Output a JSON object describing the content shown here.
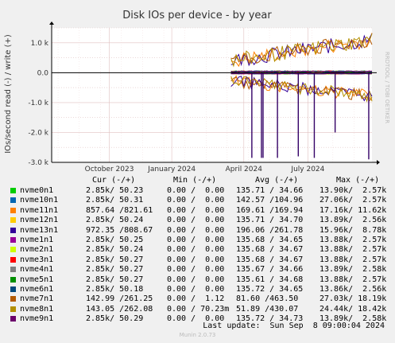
{
  "chart_data": {
    "type": "line",
    "title": "Disk IOs per device - by year",
    "ylabel": "IOs/second read (-) / write (+)",
    "watermark": "RRDTOOL / TOBI OETIKER",
    "ylim": [
      -3000,
      1500
    ],
    "y_ticks": [
      "1.5 k",
      "1.0 k",
      "0.5 k",
      "0.0",
      "-0.5 k",
      "-1.0 k",
      "-1.5 k",
      "-2.0 k",
      "-2.5 k",
      "-3.0 k"
    ],
    "x_ticks": [
      "October 2023",
      "January 2024",
      "April 2024",
      "July 2024"
    ],
    "columns": [
      "Cur (-/+)",
      "Min (-/+)",
      "Avg (-/+)",
      "Max (-/+)"
    ],
    "series": [
      {
        "name": "nvme0n1",
        "color": "#00cc00",
        "cur": "2.85k/ 50.23",
        "min": "0.00 /  0.00",
        "avg": "135.71 / 34.66",
        "max": "13.90k/  2.57k"
      },
      {
        "name": "nvme10n1",
        "color": "#0066b3",
        "cur": "2.85k/ 50.31",
        "min": "0.00 /  0.00",
        "avg": "142.57 /104.96",
        "max": "27.06k/  2.57k"
      },
      {
        "name": "nvme11n1",
        "color": "#ff8000",
        "cur": "857.64 /821.61",
        "min": "0.00 /  0.00",
        "avg": "169.61 /169.94",
        "max": "17.16k/ 11.62k"
      },
      {
        "name": "nvme12n1",
        "color": "#ffcc00",
        "cur": "2.85k/ 50.24",
        "min": "0.00 /  0.00",
        "avg": "135.71 / 34.70",
        "max": "13.89k/  2.56k"
      },
      {
        "name": "nvme13n1",
        "color": "#330099",
        "cur": "972.35 /808.67",
        "min": "0.00 /  0.00",
        "avg": "196.06 /261.78",
        "max": "15.96k/  8.78k"
      },
      {
        "name": "nvme1n1",
        "color": "#990099",
        "cur": "2.85k/ 50.25",
        "min": "0.00 /  0.00",
        "avg": "135.68 / 34.65",
        "max": "13.88k/  2.57k"
      },
      {
        "name": "nvme2n1",
        "color": "#ccff00",
        "cur": "2.85k/ 50.24",
        "min": "0.00 /  0.00",
        "avg": "135.68 / 34.67",
        "max": "13.88k/  2.57k"
      },
      {
        "name": "nvme3n1",
        "color": "#ff0000",
        "cur": "2.85k/ 50.27",
        "min": "0.00 /  0.00",
        "avg": "135.68 / 34.67",
        "max": "13.88k/  2.57k"
      },
      {
        "name": "nvme4n1",
        "color": "#808080",
        "cur": "2.85k/ 50.27",
        "min": "0.00 /  0.00",
        "avg": "135.67 / 34.66",
        "max": "13.89k/  2.58k"
      },
      {
        "name": "nvme5n1",
        "color": "#008f00",
        "cur": "2.85k/ 50.27",
        "min": "0.00 /  0.00",
        "avg": "135.61 / 34.68",
        "max": "13.88k/  2.57k"
      },
      {
        "name": "nvme6n1",
        "color": "#00487d",
        "cur": "2.85k/ 50.18",
        "min": "0.00 /  0.00",
        "avg": "135.72 / 34.65",
        "max": "13.86k/  2.56k"
      },
      {
        "name": "nvme7n1",
        "color": "#b35a00",
        "cur": "142.99 /261.25",
        "min": "0.00 /  1.12",
        "avg": "81.60 /463.50",
        "max": "27.03k/ 18.19k"
      },
      {
        "name": "nvme8n1",
        "color": "#b38f00",
        "cur": "143.05 /262.08",
        "min": "0.00 / 70.23m",
        "avg": "51.89 /430.07",
        "max": "24.44k/ 18.42k"
      },
      {
        "name": "nvme9n1",
        "color": "#6b006b",
        "cur": "2.85k/ 50.29",
        "min": "0.00 /  0.00",
        "avg": "135.72 / 34.73",
        "max": "13.89k/  2.58k"
      }
    ],
    "last_update": "Last update:  Sun Sep  8 09:00:04 2024",
    "footer": "Munin 2.0.73"
  }
}
